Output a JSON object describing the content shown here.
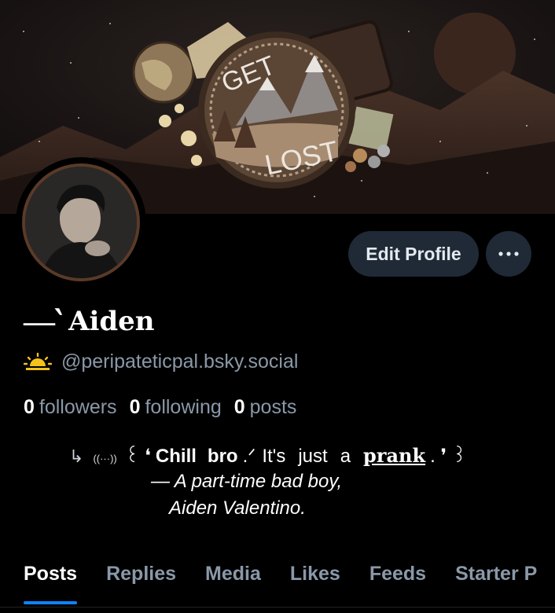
{
  "banner": {
    "patch_text_top": "GET",
    "patch_text_bottom": "LOST"
  },
  "profile": {
    "name_decoration": "—‵",
    "display_name": "Aiden",
    "handle": "@peripateticpal.bsky.social",
    "edit_profile_label": "Edit Profile",
    "more_label": "•••"
  },
  "stats": [
    {
      "value": "0",
      "label": "followers"
    },
    {
      "value": "0",
      "label": "following"
    },
    {
      "value": "0",
      "label": "posts"
    }
  ],
  "bio": {
    "arrow": "↳",
    "small": "((···))",
    "open": "꒰ ❛",
    "chill": "Chill",
    "bro": "bro",
    "slash": ".ᐟ",
    "its": "It's",
    "just": "just",
    "a": "a",
    "prank": "prank",
    "close": ". ❜ ꒱",
    "line2": "— A part-time bad boy,",
    "line3": "Aiden Valentino."
  },
  "tabs": [
    "Posts",
    "Replies",
    "Media",
    "Likes",
    "Feeds",
    "Starter P"
  ],
  "active_tab": "Posts",
  "colors": {
    "background": "#000000",
    "button": "#1f2a36",
    "muted": "#8a98a8",
    "accent": "#1083fe",
    "sun": "#f3c21b"
  }
}
